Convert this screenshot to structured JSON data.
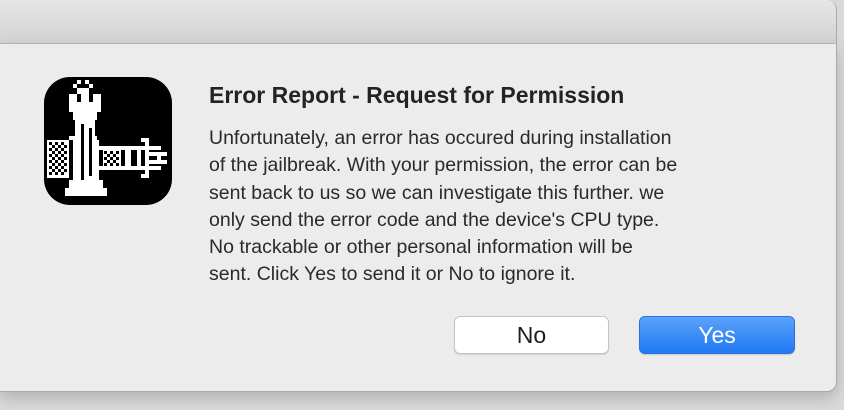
{
  "dialog": {
    "title": "Error Report - Request for Permission",
    "message_lines": [
      "Unfortunately, an error has occured during installation",
      "of the jailbreak. With your permission, the error can be",
      "sent back to us so we can investigate this further. we",
      "only send the error code and the device's CPU type.",
      "No trackable or other personal information will be",
      "sent. Click Yes to send it or No to ignore it."
    ],
    "icon": "checkra1n-chess-rook-icon",
    "buttons": {
      "no_label": "No",
      "yes_label": "Yes"
    }
  },
  "colors": {
    "accent": "#1f78f3",
    "dialog_background": "#ececec"
  }
}
